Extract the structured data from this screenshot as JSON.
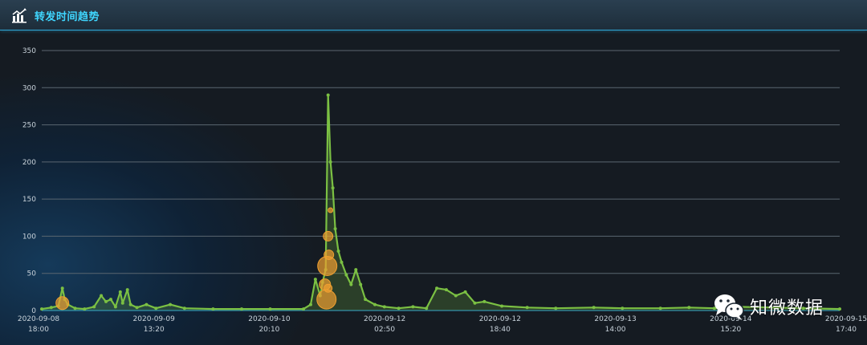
{
  "header": {
    "title": "转发时间趋势",
    "icon": "bar-trend-icon"
  },
  "watermark": {
    "text": "知微数据",
    "icon": "wechat-icon"
  },
  "chart_data": {
    "type": "line",
    "title": "转发时间趋势",
    "xlabel": "",
    "ylabel": "",
    "ylim": [
      0,
      350
    ],
    "yticks": [
      0,
      50,
      100,
      150,
      200,
      250,
      300,
      350
    ],
    "grid": true,
    "line_color": "#7bc043",
    "bubble_color": "#f0a030",
    "x_tick_labels": [
      {
        "date": "2020-09-08",
        "time": "18:00"
      },
      {
        "date": "2020-09-09",
        "time": "13:20"
      },
      {
        "date": "2020-09-10",
        "time": "20:10"
      },
      {
        "date": "2020-09-12",
        "time": "02:50"
      },
      {
        "date": "2020-09-12",
        "time": "18:40"
      },
      {
        "date": "2020-09-13",
        "time": "14:00"
      },
      {
        "date": "2020-09-14",
        "time": "15:20"
      },
      {
        "date": "2020-09-15",
        "time": "17:40"
      }
    ],
    "x_domain": [
      "2020-09-08 18:00",
      "2020-09-15 17:40"
    ],
    "series": [
      {
        "values": [
          [
            "2020-09-08 18:00",
            2
          ],
          [
            "2020-09-08 20:00",
            4
          ],
          [
            "2020-09-08 21:30",
            6
          ],
          [
            "2020-09-08 22:20",
            30
          ],
          [
            "2020-09-08 22:50",
            15
          ],
          [
            "2020-09-08 23:30",
            8
          ],
          [
            "2020-09-09 01:00",
            3
          ],
          [
            "2020-09-09 03:00",
            2
          ],
          [
            "2020-09-09 05:00",
            5
          ],
          [
            "2020-09-09 06:30",
            20
          ],
          [
            "2020-09-09 07:30",
            12
          ],
          [
            "2020-09-09 08:30",
            15
          ],
          [
            "2020-09-09 09:30",
            5
          ],
          [
            "2020-09-09 10:30",
            25
          ],
          [
            "2020-09-09 11:00",
            10
          ],
          [
            "2020-09-09 12:00",
            28
          ],
          [
            "2020-09-09 12:40",
            8
          ],
          [
            "2020-09-09 14:00",
            4
          ],
          [
            "2020-09-09 16:00",
            8
          ],
          [
            "2020-09-09 18:00",
            3
          ],
          [
            "2020-09-09 21:00",
            8
          ],
          [
            "2020-09-10 00:00",
            3
          ],
          [
            "2020-09-10 06:00",
            2
          ],
          [
            "2020-09-10 12:00",
            2
          ],
          [
            "2020-09-10 18:00",
            2
          ],
          [
            "2020-09-11 01:00",
            2
          ],
          [
            "2020-09-11 02:30",
            8
          ],
          [
            "2020-09-11 03:30",
            42
          ],
          [
            "2020-09-11 04:30",
            20
          ],
          [
            "2020-09-11 05:00",
            38
          ],
          [
            "2020-09-11 05:40",
            55
          ],
          [
            "2020-09-11 06:10",
            290
          ],
          [
            "2020-09-11 06:40",
            200
          ],
          [
            "2020-09-11 07:10",
            165
          ],
          [
            "2020-09-11 07:40",
            110
          ],
          [
            "2020-09-11 08:20",
            80
          ],
          [
            "2020-09-11 09:00",
            65
          ],
          [
            "2020-09-11 10:00",
            48
          ],
          [
            "2020-09-11 11:00",
            35
          ],
          [
            "2020-09-11 12:00",
            55
          ],
          [
            "2020-09-11 13:00",
            35
          ],
          [
            "2020-09-11 14:00",
            15
          ],
          [
            "2020-09-11 16:00",
            8
          ],
          [
            "2020-09-11 18:00",
            5
          ],
          [
            "2020-09-11 21:00",
            3
          ],
          [
            "2020-09-12 00:00",
            5
          ],
          [
            "2020-09-12 02:50",
            3
          ],
          [
            "2020-09-12 05:00",
            30
          ],
          [
            "2020-09-12 07:00",
            28
          ],
          [
            "2020-09-12 09:00",
            20
          ],
          [
            "2020-09-12 11:00",
            25
          ],
          [
            "2020-09-12 13:00",
            10
          ],
          [
            "2020-09-12 15:00",
            12
          ],
          [
            "2020-09-12 18:40",
            6
          ],
          [
            "2020-09-13 00:00",
            4
          ],
          [
            "2020-09-13 06:00",
            3
          ],
          [
            "2020-09-13 14:00",
            4
          ],
          [
            "2020-09-13 20:00",
            3
          ],
          [
            "2020-09-14 04:00",
            3
          ],
          [
            "2020-09-14 10:00",
            4
          ],
          [
            "2020-09-14 15:20",
            3
          ],
          [
            "2020-09-14 20:00",
            5
          ],
          [
            "2020-09-15 04:00",
            4
          ],
          [
            "2020-09-15 10:00",
            3
          ],
          [
            "2020-09-15 17:40",
            2
          ]
        ]
      }
    ],
    "bubbles": [
      {
        "x": "2020-09-08 22:20",
        "y": 10,
        "size": 8
      },
      {
        "x": "2020-09-11 05:30",
        "y": 35,
        "size": 7
      },
      {
        "x": "2020-09-11 05:50",
        "y": 15,
        "size": 12
      },
      {
        "x": "2020-09-11 06:00",
        "y": 60,
        "size": 12
      },
      {
        "x": "2020-09-11 06:10",
        "y": 100,
        "size": 6
      },
      {
        "x": "2020-09-11 06:20",
        "y": 75,
        "size": 6
      },
      {
        "x": "2020-09-11 06:40",
        "y": 135,
        "size": 3
      },
      {
        "x": "2020-09-11 06:10",
        "y": 30,
        "size": 5
      }
    ]
  }
}
